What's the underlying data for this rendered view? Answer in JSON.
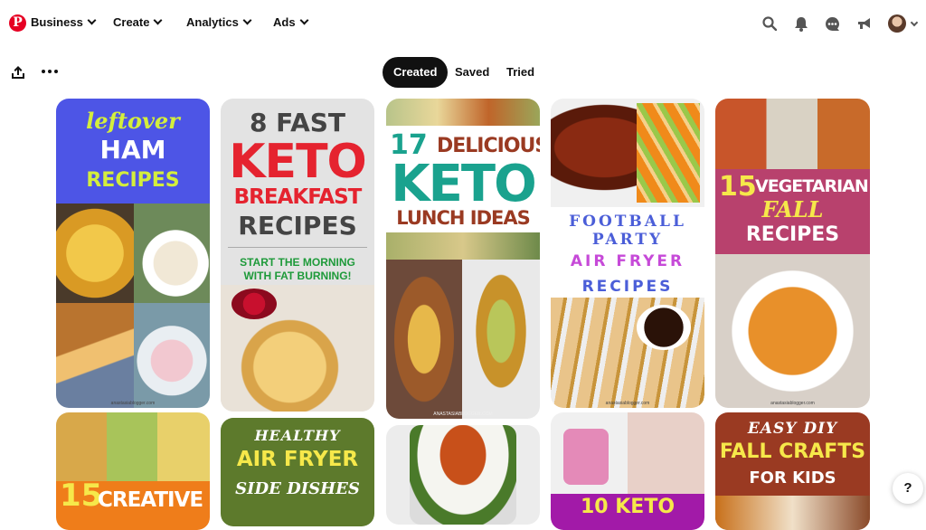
{
  "nav": {
    "logo": "P",
    "items": [
      {
        "label": "Business"
      },
      {
        "label": "Create"
      },
      {
        "label": "Analytics"
      },
      {
        "label": "Ads"
      }
    ]
  },
  "tabs": [
    {
      "label": "Created",
      "active": true
    },
    {
      "label": "Saved"
    },
    {
      "label": "Tried"
    }
  ],
  "help": "?",
  "pins": {
    "p1": {
      "line1": "leftover",
      "line2": "HAM",
      "line3": "RECIPES",
      "watermark": "anastasiablogger.com"
    },
    "p2": {
      "line1": "8 FAST",
      "line2": "KETO",
      "line3": "BREAKFAST",
      "line4": "RECIPES",
      "line5": "START THE MORNING",
      "line6": "WITH FAT BURNING!"
    },
    "p3": {
      "num": "17",
      "line1": "DELICIOUS",
      "line2": "KETO",
      "line3": "LUNCH IDEAS",
      "watermark": "ANASTASIABLOGGER.COM"
    },
    "p4": {
      "line1": "FOOTBALL",
      "line2": "PARTY",
      "line3": "AIR FRYER",
      "line4": "RECIPES",
      "watermark": "anastasiablogger.com"
    },
    "p5": {
      "num": "15",
      "line1": "VEGETARIAN",
      "line2": "FALL",
      "line3": "RECIPES",
      "watermark": "anastasiablogger.com"
    },
    "p6": {
      "num": "15",
      "line1": "CREATIVE"
    },
    "p7": {
      "line1": "HEALTHY",
      "line2": "AIR FRYER",
      "line3": "SIDE DISHES"
    },
    "p9": {
      "line1": "10 KETO"
    },
    "p10": {
      "line1": "EASY DIY",
      "line2": "FALL CRAFTS",
      "line3": "FOR KIDS"
    }
  },
  "colors": {
    "brand_red": "#e60023",
    "keto_red": "#e5232f",
    "teal": "#1aa28e",
    "magenta_band": "#b8416d",
    "ham_blue": "#4d55e6",
    "olive": "#5d7a2c",
    "rust": "#9a3a22"
  }
}
